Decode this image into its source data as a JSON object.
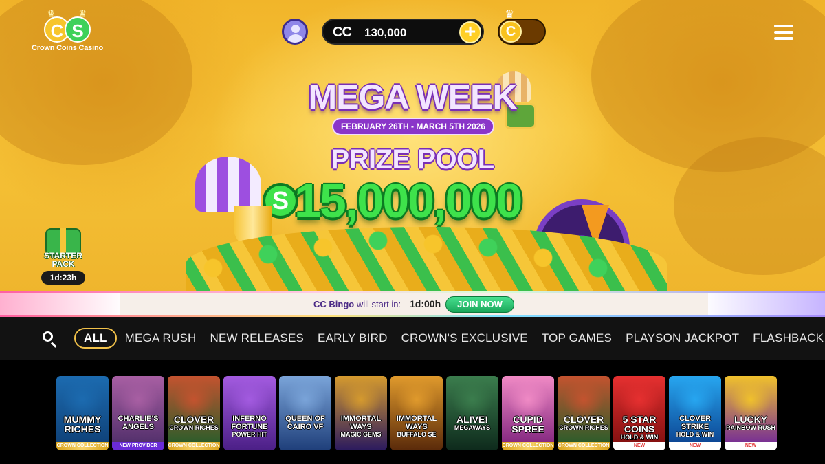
{
  "header": {
    "logo_text": "Crown Coins Casino",
    "logo_letters": [
      "C",
      "S"
    ],
    "balance_currency": "CC",
    "balance_amount": "130,000",
    "add_label": "+",
    "sc_coin_letter": "C"
  },
  "promo": {
    "title": "MEGA WEEK",
    "dates": "FEBRUARY 26TH - MARCH 5TH 2026",
    "prize_label": "PRIZE POOL",
    "prize_currency_symbol": "S",
    "prize_amount": "15,000,000",
    "starter_pack_line1": "STARTER",
    "starter_pack_line2": "PACK",
    "starter_pack_timer": "1d:23h"
  },
  "bingo": {
    "name": "CC Bingo",
    "label": "will start in:",
    "countdown": "1d:00h",
    "join_label": "JOIN NOW"
  },
  "nav": {
    "tabs": [
      "ALL",
      "MEGA RUSH",
      "NEW RELEASES",
      "EARLY BIRD",
      "CROWN'S EXCLUSIVE",
      "TOP GAMES",
      "PLAYSON JACKPOT",
      "FLASHBACK FAV"
    ],
    "active_tab": "ALL"
  },
  "games": [
    {
      "name": "MUMMY RICHES",
      "sub": "",
      "tag": "CROWN COLLECTION",
      "tag_type": "crown",
      "colors": [
        "#0e3e74",
        "#1c6bb0"
      ]
    },
    {
      "name": "CHARLIE'S ANGELS",
      "sub": "",
      "tag": "NEW PROVIDER",
      "tag_type": "provider",
      "colors": [
        "#4a2b66",
        "#a85fa3"
      ]
    },
    {
      "name": "CLOVER",
      "sub": "CROWN RICHES",
      "tag": "CROWN COLLECTION",
      "tag_type": "crown",
      "colors": [
        "#1c5e2a",
        "#c4532f"
      ]
    },
    {
      "name": "INFERNO FORTUNE",
      "sub": "POWER HIT",
      "tag": "",
      "tag_type": "",
      "colors": [
        "#4b1f86",
        "#a35be0"
      ]
    },
    {
      "name": "QUEEN OF CAIRO VF",
      "sub": "",
      "tag": "",
      "tag_type": "",
      "colors": [
        "#1f3f7a",
        "#7aa4d9"
      ]
    },
    {
      "name": "IMMORTAL WAYS",
      "sub": "MAGIC GEMS",
      "tag": "",
      "tag_type": "",
      "colors": [
        "#2b1a5e",
        "#d59a2e"
      ]
    },
    {
      "name": "IMMORTAL WAYS",
      "sub": "BUFFALO SE",
      "tag": "",
      "tag_type": "",
      "colors": [
        "#5a2a0a",
        "#e09a2c"
      ]
    },
    {
      "name": "ALIVE!",
      "sub": "MEGAWAYS",
      "tag": "",
      "tag_type": "",
      "colors": [
        "#0e2a1c",
        "#3b7d4d"
      ]
    },
    {
      "name": "CUPID SPREE",
      "sub": "",
      "tag": "CROWN COLLECTION",
      "tag_type": "crown",
      "colors": [
        "#7a1f7a",
        "#f08ac5"
      ]
    },
    {
      "name": "CLOVER",
      "sub": "CROWN RICHES",
      "tag": "CROWN COLLECTION",
      "tag_type": "crown",
      "colors": [
        "#1c5e2a",
        "#c4532f"
      ]
    },
    {
      "name": "5 STAR COINS",
      "sub": "HOLD & WIN",
      "tag": "NEW",
      "tag_type": "new",
      "colors": [
        "#7a0d0d",
        "#e63030"
      ]
    },
    {
      "name": "CLOVER STRIKE",
      "sub": "HOLD & WIN",
      "tag": "NEW",
      "tag_type": "new",
      "colors": [
        "#0a3c8a",
        "#27a6f0"
      ]
    },
    {
      "name": "LUCKY",
      "sub": "RAINBOW RUSH",
      "tag": "NEW",
      "tag_type": "new",
      "colors": [
        "#6a1fa0",
        "#f0c12c"
      ]
    }
  ],
  "colors": {
    "accent_gold": "#f2c24a",
    "brand_green": "#3ee24b",
    "brand_purple": "#8a35c9"
  }
}
